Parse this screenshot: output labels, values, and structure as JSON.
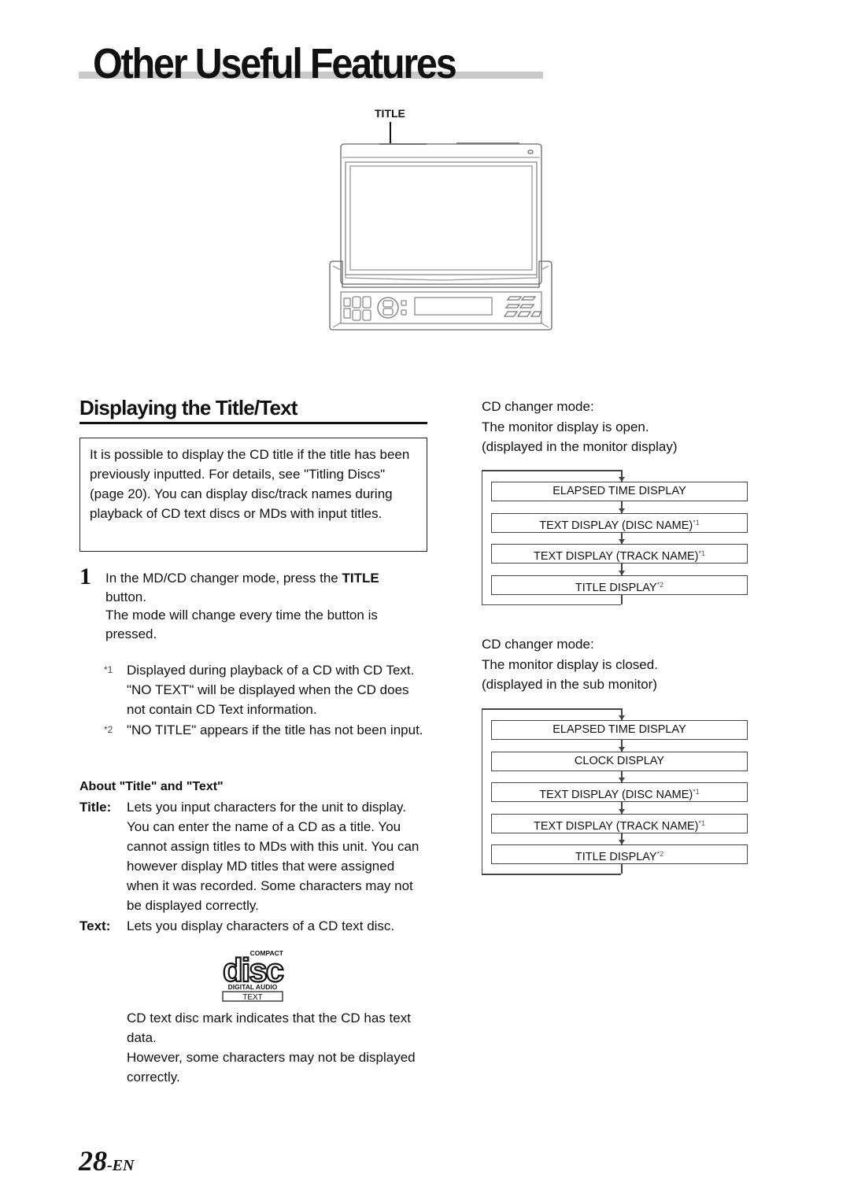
{
  "page": {
    "title": "Other Useful Features",
    "number": "28",
    "number_suffix": "-EN"
  },
  "illustration": {
    "callout_label": "TITLE",
    "device": "head-unit-with-monitor"
  },
  "section": {
    "heading": "Displaying the Title/Text",
    "intro": "It is possible to display the CD title if the title has been previously inputted. For details, see \"Titling Discs\" (page 20). You can display disc/track names during playback of CD text discs or MDs with input titles."
  },
  "step": {
    "number": "1",
    "text_before": "In the MD/CD changer mode, press the ",
    "button_name": "TITLE",
    "text_after": " button.",
    "result": "The mode will change every time the button is pressed."
  },
  "notes": [
    {
      "mark": "*1",
      "text": "Displayed during playback of a CD with CD Text. \"NO TEXT\" will be displayed when the CD does not contain CD Text information."
    },
    {
      "mark": "*2",
      "text": "\"NO TITLE\" appears if the title has not been input."
    }
  ],
  "about": {
    "heading": "About \"Title\" and \"Text\"",
    "definitions": [
      {
        "term": "Title:",
        "description": "Lets you input characters for the unit to display. You can enter the name of a CD as a title. You cannot assign titles to MDs with this unit. You can however display MD titles that were assigned when it was recorded. Some characters may not be displayed correctly."
      },
      {
        "term": "Text:",
        "description": "Lets you display characters of a CD text disc."
      }
    ]
  },
  "cd_logo": {
    "line1": "COMPACT",
    "line2": "disc",
    "line3": "DIGITAL AUDIO",
    "line4": "TEXT"
  },
  "logo_caption": {
    "line1": "CD text disc mark indicates that the CD has text data.",
    "line2": "However, some characters may not be displayed correctly."
  },
  "modes": [
    {
      "desc_lines": [
        "CD changer mode:",
        "The monitor display is open.",
        "(displayed in the monitor display)"
      ],
      "flow": [
        {
          "label": "ELAPSED TIME DISPLAY",
          "note": ""
        },
        {
          "label": "TEXT DISPLAY (DISC NAME)",
          "note": "*1"
        },
        {
          "label": "TEXT DISPLAY (TRACK NAME)",
          "note": "*1"
        },
        {
          "label": "TITLE DISPLAY",
          "note": "*2"
        }
      ]
    },
    {
      "desc_lines": [
        "CD changer mode:",
        "The monitor display is closed.",
        "(displayed in the sub monitor)"
      ],
      "flow": [
        {
          "label": "ELAPSED TIME DISPLAY",
          "note": ""
        },
        {
          "label": "CLOCK DISPLAY",
          "note": ""
        },
        {
          "label": "TEXT DISPLAY (DISC NAME)",
          "note": "*1"
        },
        {
          "label": "TEXT DISPLAY (TRACK NAME)",
          "note": "*1"
        },
        {
          "label": "TITLE DISPLAY",
          "note": "*2"
        }
      ]
    }
  ]
}
